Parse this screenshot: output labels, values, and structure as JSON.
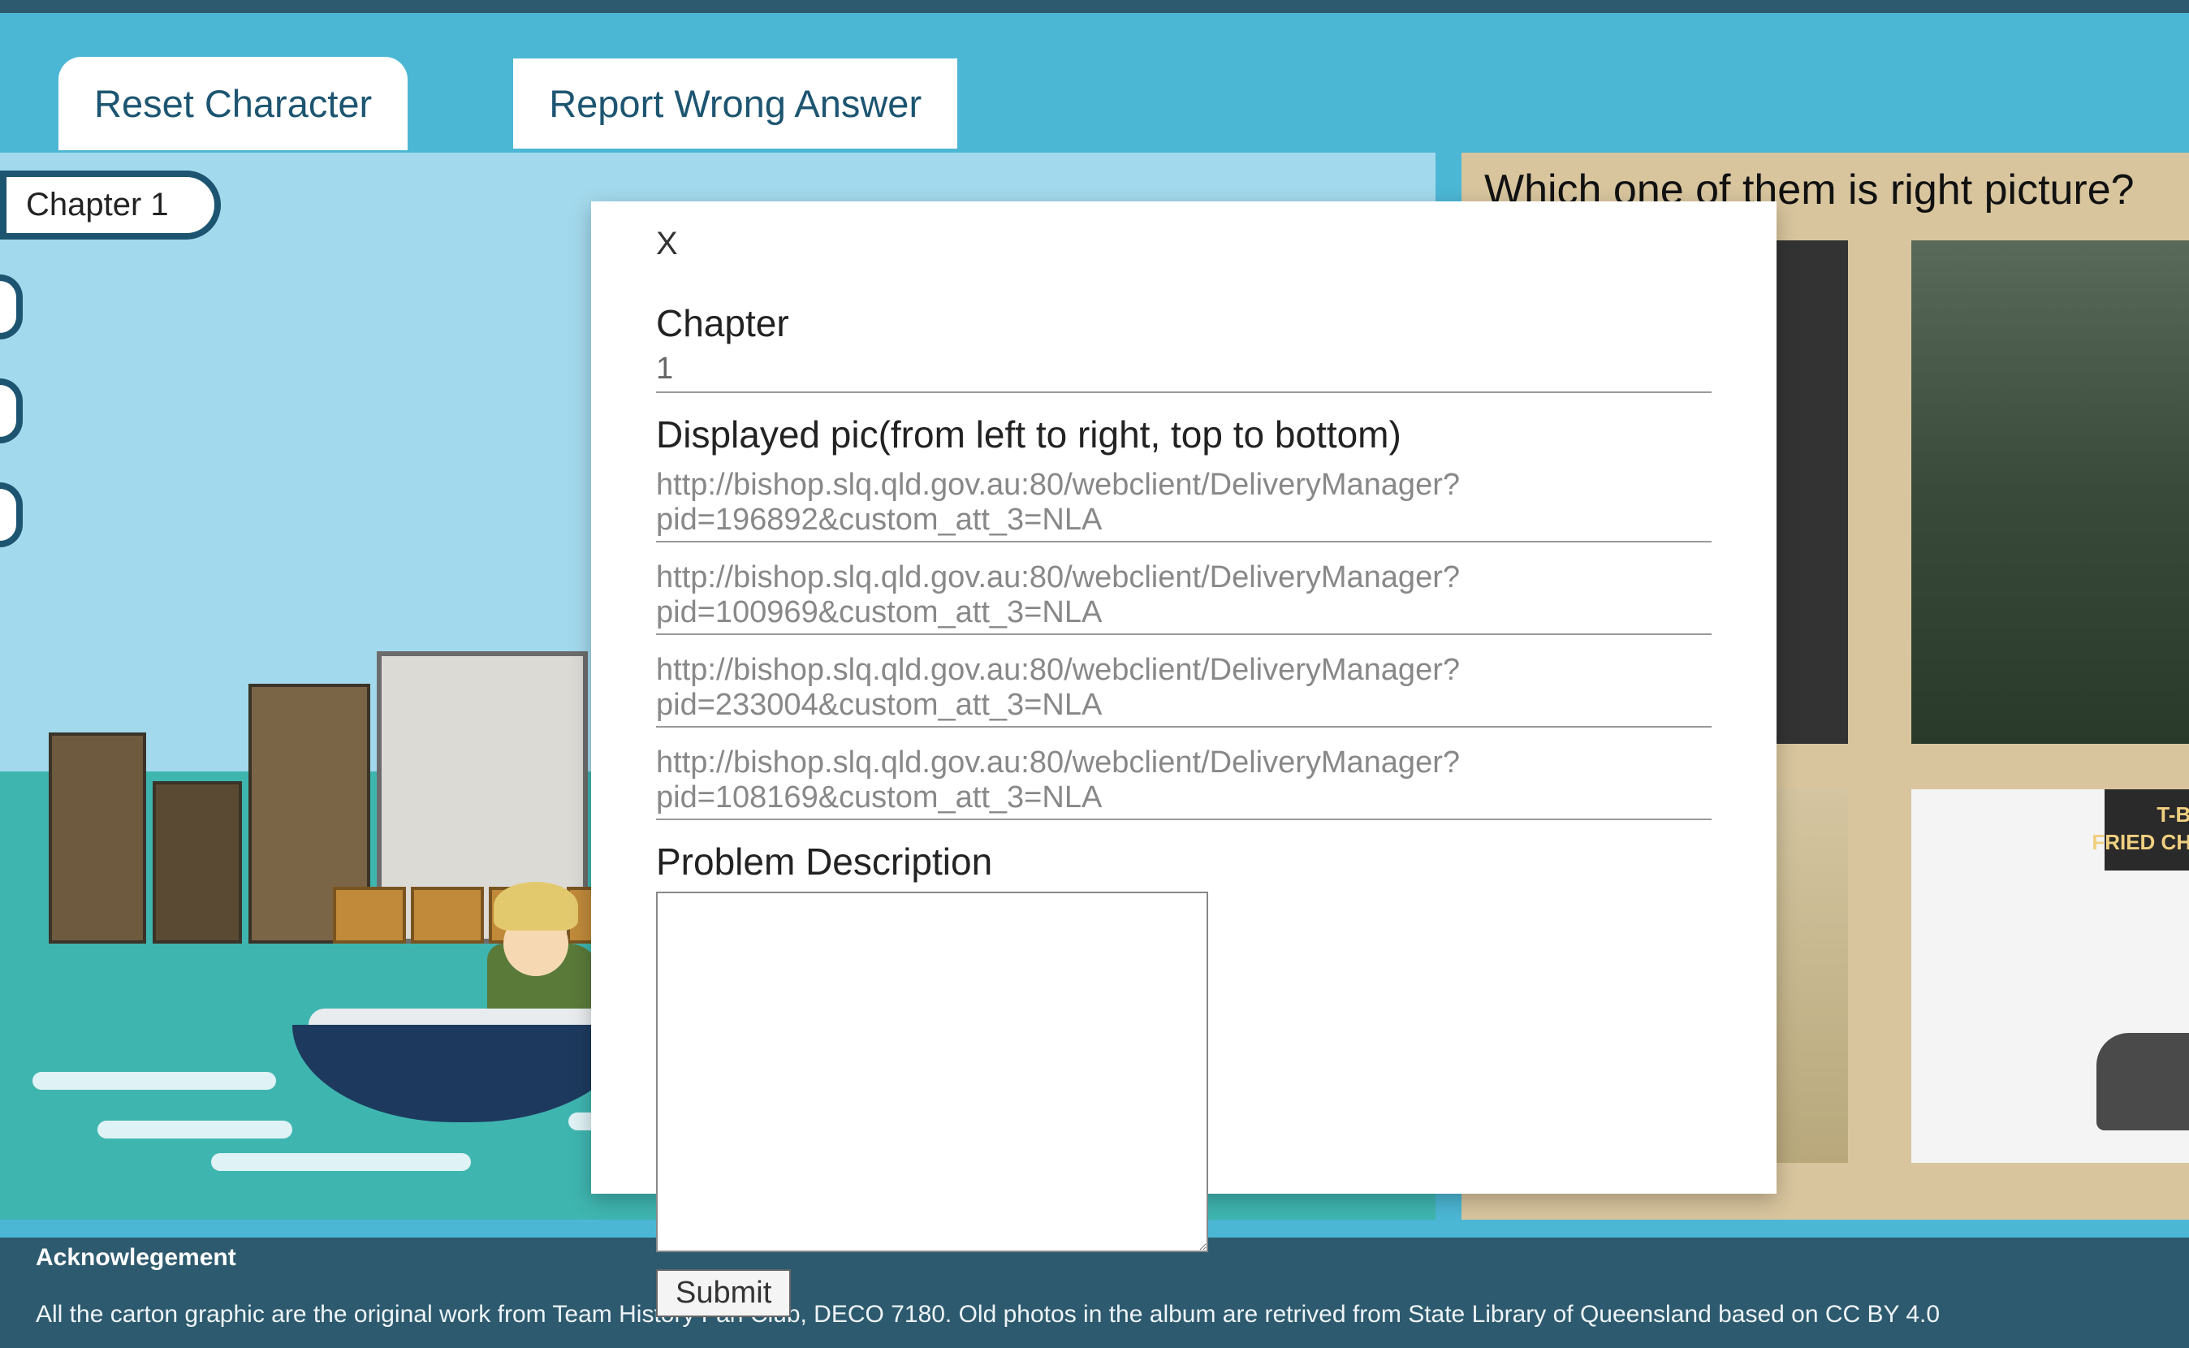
{
  "tabs": {
    "reset": "Reset Character",
    "report": "Report Wrong Answer"
  },
  "chapter_pill": "Chapter 1",
  "right_panel": {
    "question": "Which one of them is right picture?"
  },
  "modal": {
    "close": "X",
    "chapter_label": "Chapter",
    "chapter_value": "1",
    "displayed_label": "Displayed pic(from left to right, top to bottom)",
    "urls": [
      "http://bishop.slq.qld.gov.au:80/webclient/DeliveryManager?pid=196892&custom_att_3=NLA",
      "http://bishop.slq.qld.gov.au:80/webclient/DeliveryManager?pid=100969&custom_att_3=NLA",
      "http://bishop.slq.qld.gov.au:80/webclient/DeliveryManager?pid=233004&custom_att_3=NLA",
      "http://bishop.slq.qld.gov.au:80/webclient/DeliveryManager?pid=108169&custom_att_3=NLA"
    ],
    "problem_label": "Problem Description",
    "problem_value": "",
    "submit": "Submit"
  },
  "footer": {
    "title": "Acknowlegement",
    "text": "All the carton graphic are the original work from Team History Fan Club, DECO 7180. Old photos in the album are retrived from State Library of Queensland based on CC BY 4.0"
  },
  "pic4_sign": "FRIED CHICKEN",
  "pic4_sign2": "T-BONES"
}
